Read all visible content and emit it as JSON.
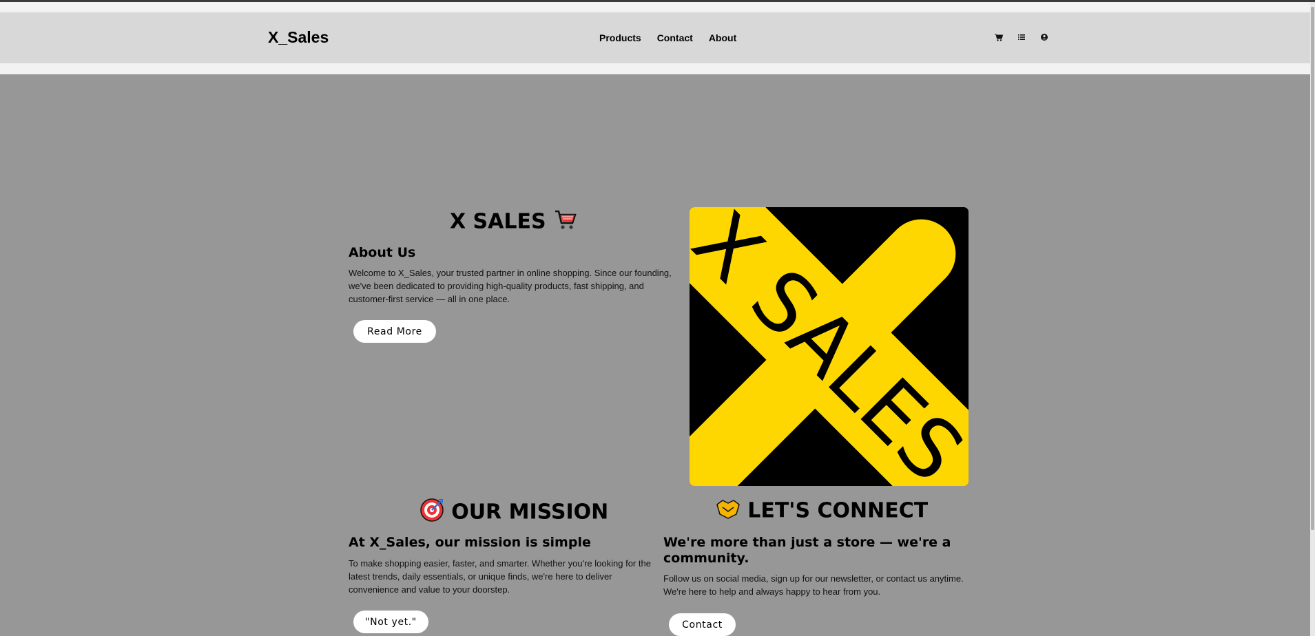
{
  "header": {
    "brand": "X_Sales",
    "nav": [
      "Products",
      "Contact",
      "About"
    ],
    "icons": [
      "cart-icon",
      "list-icon",
      "user-icon"
    ]
  },
  "about": {
    "title": "X SALES",
    "title_icon": "shopping-cart-icon",
    "heading": "About Us",
    "text": "Welcome to X_Sales, your trusted partner in online shopping. Since our founding, we've been dedicated to providing high-quality products, fast shipping, and customer-first service — all in one place.",
    "button": "Read More"
  },
  "logo": {
    "text": "X SALES",
    "colors": {
      "background": "#000000",
      "stripe": "#FFD700"
    }
  },
  "mission": {
    "title": "OUR MISSION",
    "title_icon": "target-icon",
    "heading": "At X_Sales, our mission is simple",
    "text": "To make shopping easier, faster, and smarter. Whether you're looking for the latest trends, daily essentials, or unique finds, we're here to deliver convenience and value to your doorstep.",
    "button": "\"Not yet.\""
  },
  "connect": {
    "title": "LET'S CONNECT",
    "title_icon": "handshake-icon",
    "heading": "We're more than just a store — we're a community.",
    "text": "Follow us on social media, sign up for our newsletter, or contact us anytime. We're here to help and always happy to hear from you.",
    "button": "Contact"
  }
}
